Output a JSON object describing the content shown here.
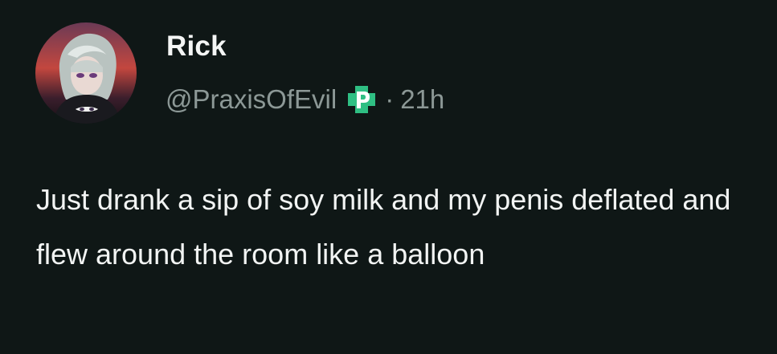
{
  "author": {
    "display_name": "Rick",
    "handle": "@PraxisOfEvil",
    "badge_icon": "green-p-badge-icon",
    "separator": "·",
    "timestamp": "21h"
  },
  "post": {
    "text": "Just drank a sip of soy milk and my penis deflated and flew around the room like a balloon"
  },
  "colors": {
    "background": "#0f1716",
    "text_primary": "#f2f4f3",
    "text_secondary": "#8c9896",
    "badge_green": "#2fbf83"
  }
}
